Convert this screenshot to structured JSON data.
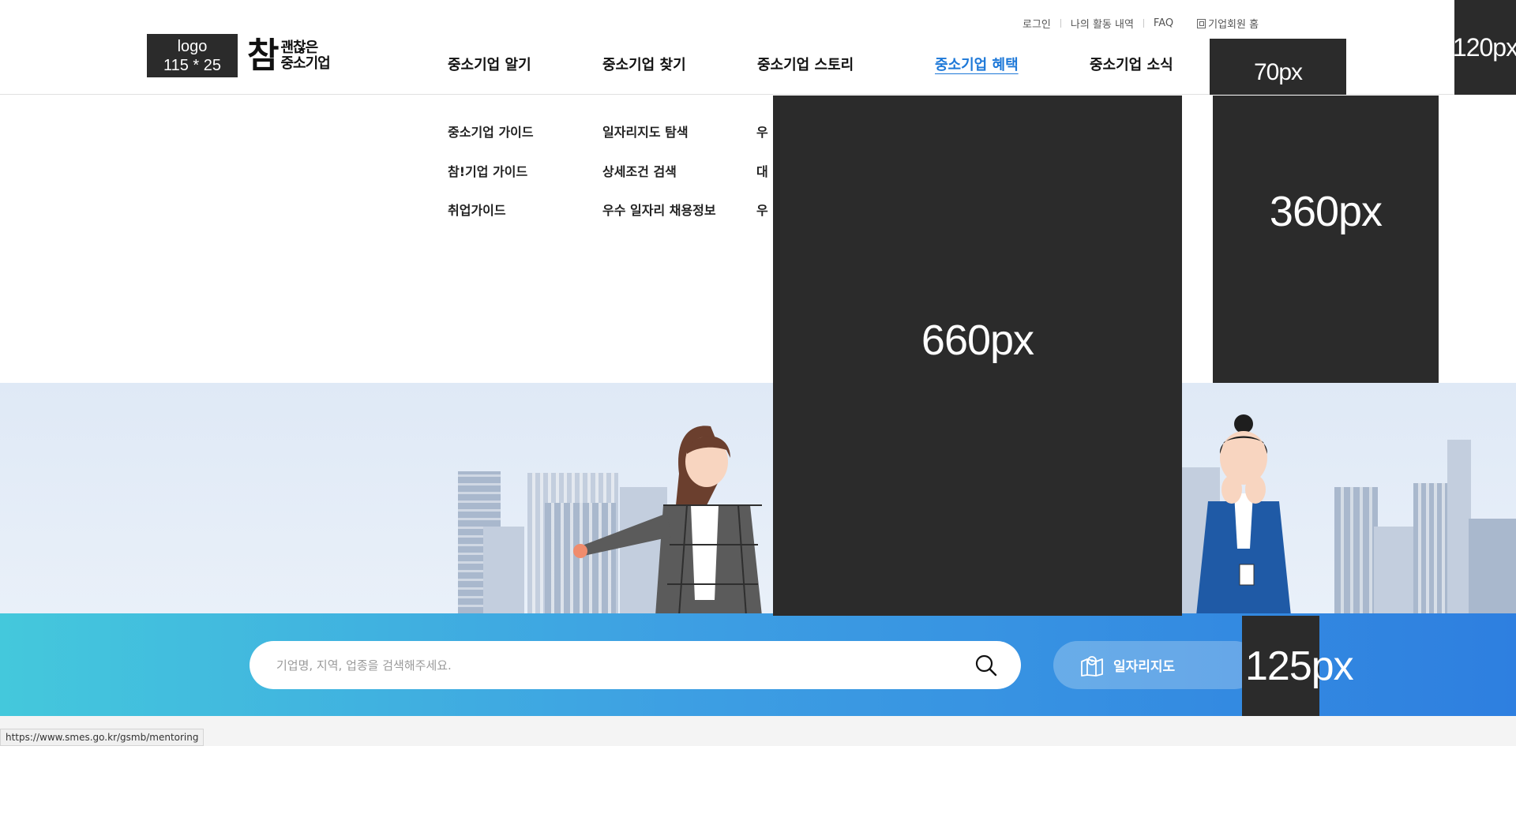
{
  "header": {
    "logo_placeholder": "logo\n115 * 25",
    "brand_big": "참",
    "brand_small": "괜찮은\n중소기업",
    "util_links": [
      "로그인",
      "나의 활동 내역",
      "FAQ",
      "기업회원 홈"
    ],
    "gnb": [
      "중소기업 알기",
      "중소기업 찾기",
      "중소기업 스토리",
      "중소기업 혜택",
      "중소기업 소식"
    ],
    "active_menu": "중소기업 혜택"
  },
  "dropdown": {
    "col1": [
      "중소기업 가이드",
      "참!기업 가이드",
      "취업가이드"
    ],
    "col2": [
      "일자리지도 탐색",
      "상세조건 검색",
      "우수 일자리 채용정보"
    ],
    "col3": [
      "우",
      "대",
      "우"
    ]
  },
  "search": {
    "placeholder": "기업명, 지역, 업종을 검색해주세요.",
    "jobmap_label": "일자리지도"
  },
  "status_url": "https://www.smes.go.kr/gsmb/mentoring",
  "placeholders": {
    "top_right": "120px",
    "header_box": "70px",
    "big_center": "660px",
    "right_box": "360px",
    "small_box": "125px"
  },
  "colors": {
    "active_menu": "#1d78d8",
    "placeholder_bg": "#2b2b2b",
    "band_start": "#44c8dc",
    "band_end": "#2e7fe0"
  }
}
